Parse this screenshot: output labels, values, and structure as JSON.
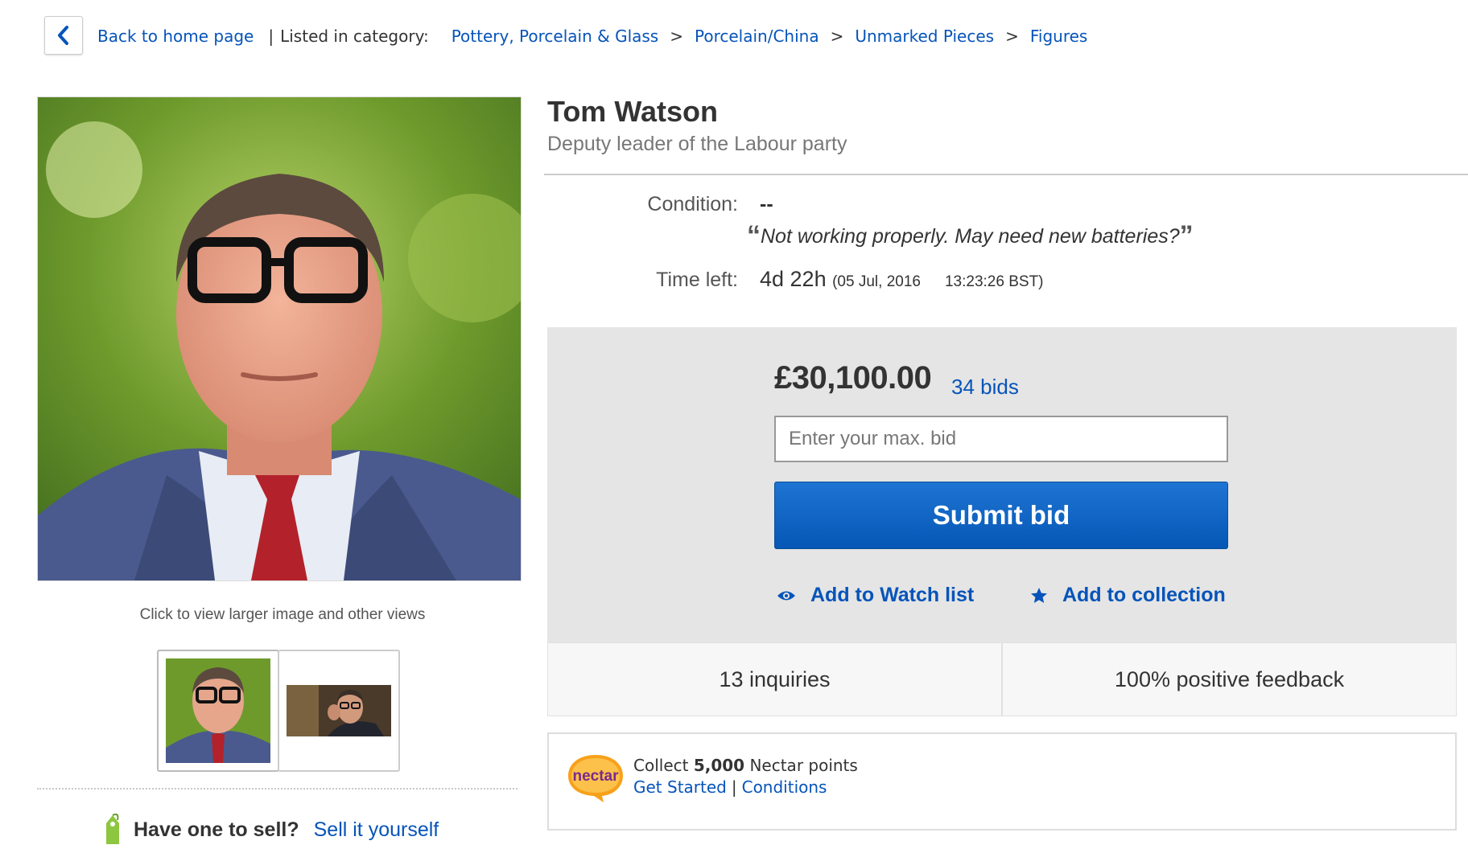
{
  "breadcrumb": {
    "back_label": "Back to home page",
    "listed_label": "Listed in category:",
    "items": [
      "Pottery, Porcelain & Glass",
      "Porcelain/China",
      "Unmarked Pieces",
      "Figures"
    ]
  },
  "gallery": {
    "caption": "Click to view larger image and other views",
    "thumb_count": 2
  },
  "sell": {
    "question": "Have one to sell?",
    "link": "Sell it yourself"
  },
  "item": {
    "title": "Tom Watson",
    "subtitle": "Deputy leader of the Labour party",
    "condition_label": "Condition:",
    "condition_value": "--",
    "condition_note": "Not working properly. May need new batteries?",
    "time_left_label": "Time left:",
    "time_left_value": "4d 22h",
    "end_date": "(05 Jul, 2016",
    "end_time": "13:23:26 BST)"
  },
  "bidding": {
    "price": "£30,100.00",
    "bid_count": "34 bids",
    "input_placeholder": "Enter your max. bid",
    "submit_label": "Submit bid",
    "watch_label": "Add to Watch list",
    "collection_label": "Add to collection"
  },
  "stats": {
    "inquiries": "13 inquiries",
    "feedback": "100% positive feedback"
  },
  "nectar": {
    "logo_text": "nectar",
    "collect_prefix": "Collect",
    "points": "5,000",
    "collect_suffix": "Nectar points",
    "get_started": "Get Started",
    "conditions": "Conditions"
  },
  "colors": {
    "link": "#0654ba",
    "button": "#0657b6",
    "panel": "#e5e5e5",
    "nectar_orange": "#f7a11a",
    "nectar_purple": "#7b2a8c",
    "tag_green": "#8dc63f"
  }
}
